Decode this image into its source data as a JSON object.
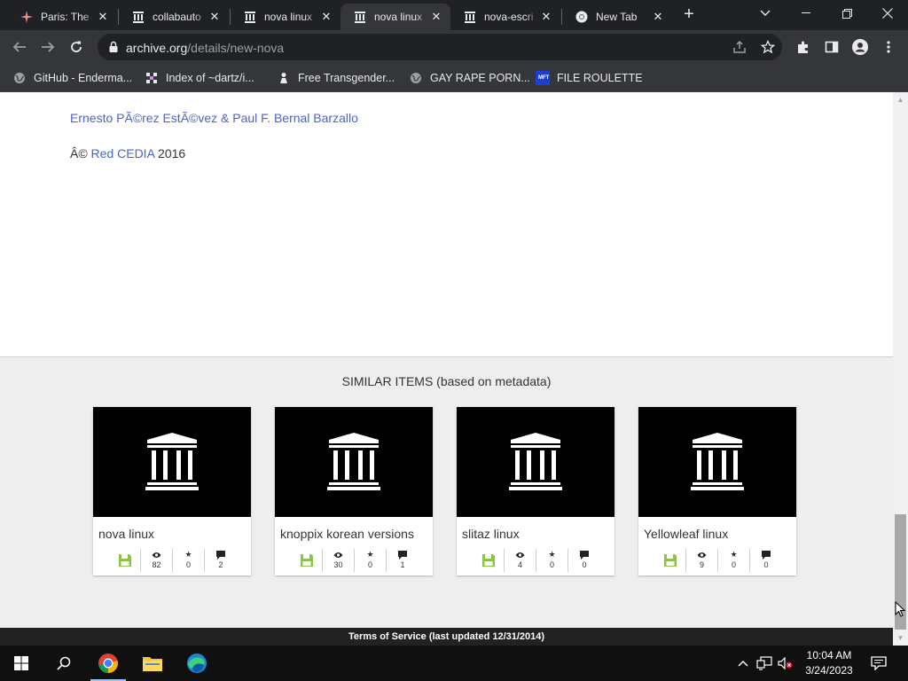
{
  "tabs": [
    {
      "title": "Paris: The",
      "icon": "sparkle-icon",
      "active": false
    },
    {
      "title": "collabauto",
      "icon": "archive-icon",
      "active": false
    },
    {
      "title": "nova linux",
      "icon": "archive-icon",
      "active": false
    },
    {
      "title": "nova linux",
      "icon": "archive-icon",
      "active": true
    },
    {
      "title": "nova-escri",
      "icon": "archive-icon",
      "active": false
    },
    {
      "title": "New Tab",
      "icon": "chrome-icon",
      "active": false
    }
  ],
  "omnibox": {
    "host": "archive.org",
    "path": "/details/new-nova"
  },
  "bookmarks": [
    {
      "label": "GitHub - Enderma...",
      "icon": "globe-icon"
    },
    {
      "label": "Index of ~dartz/i...",
      "icon": "pixel-icon"
    },
    {
      "label": "Free Transgender...",
      "icon": "figure-icon"
    },
    {
      "label": "GAY RAPE PORN...",
      "icon": "globe-icon"
    },
    {
      "label": "FILE ROULETTE",
      "icon": "mft-icon"
    }
  ],
  "bookmark_mft_text": "MFT",
  "content": {
    "authors": "Ernesto PÃ©rez EstÃ©vez & Paul F. Bernal Barzallo",
    "copyright_symbol": "Â©",
    "org": "Red CEDIA",
    "year": "2016"
  },
  "similar": {
    "title": "SIMILAR ITEMS (based on metadata)",
    "items": [
      {
        "title": "nova linux",
        "views": "82",
        "favorites": "0",
        "reviews": "2"
      },
      {
        "title": "knoppix korean versions",
        "views": "30",
        "favorites": "0",
        "reviews": "1"
      },
      {
        "title": "slitaz linux",
        "views": "4",
        "favorites": "0",
        "reviews": "0"
      },
      {
        "title": "Yellowleaf linux",
        "views": "9",
        "favorites": "0",
        "reviews": "0"
      }
    ]
  },
  "footer": {
    "text": "Terms of Service (last updated 12/31/2014)"
  },
  "taskbar": {
    "time": "10:04 AM",
    "date": "3/24/2023"
  },
  "colors": {
    "link": "#4b64c8",
    "favorite_icon": "#8bc34a",
    "page_bg": "#ffffff",
    "similar_bg": "#eeeeee"
  }
}
